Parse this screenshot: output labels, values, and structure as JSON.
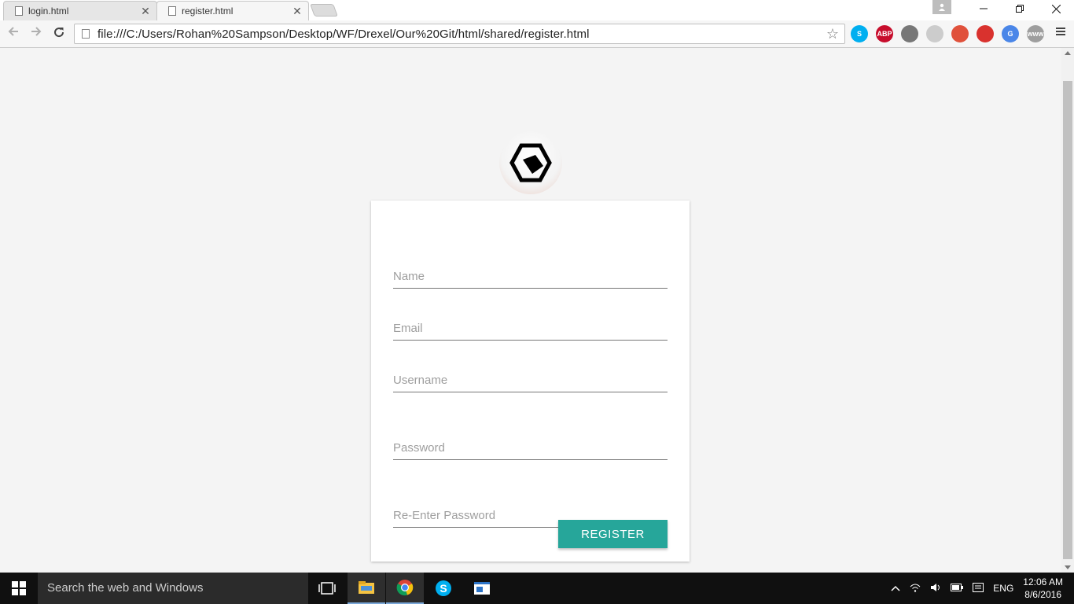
{
  "browser": {
    "tabs": [
      {
        "title": "login.html",
        "active": false
      },
      {
        "title": "register.html",
        "active": true
      }
    ],
    "close_glyph": "✕",
    "address": "file:///C:/Users/Rohan%20Sampson/Desktop/WF/Drexel/Our%20Git/html/shared/register.html",
    "extensions": [
      {
        "name": "skype-icon",
        "label": "S",
        "color": "#00aff0"
      },
      {
        "name": "adblock-plus-icon",
        "label": "ABP",
        "color": "#c70d2c"
      },
      {
        "name": "lightbulb-icon",
        "label": "",
        "color": "#777777"
      },
      {
        "name": "refresh-extension-icon",
        "label": "",
        "color": "#cccccc"
      },
      {
        "name": "no-entry-icon",
        "label": "",
        "color": "#e0513b"
      },
      {
        "name": "record-icon",
        "label": "",
        "color": "#d9322e"
      },
      {
        "name": "google-translate-icon",
        "label": "G",
        "color": "#4a86e8"
      },
      {
        "name": "www-icon",
        "label": "www",
        "color": "#9e9e9e"
      }
    ]
  },
  "form": {
    "name_placeholder": "Name",
    "email_placeholder": "Email",
    "username_placeholder": "Username",
    "password_placeholder": "Password",
    "reenter_placeholder": "Re-Enter Password",
    "register_label": "REGISTER",
    "accent_color": "#26a69a"
  },
  "taskbar": {
    "search_placeholder": "Search the web and Windows",
    "language": "ENG",
    "time": "12:06 AM",
    "date": "8/6/2016"
  }
}
